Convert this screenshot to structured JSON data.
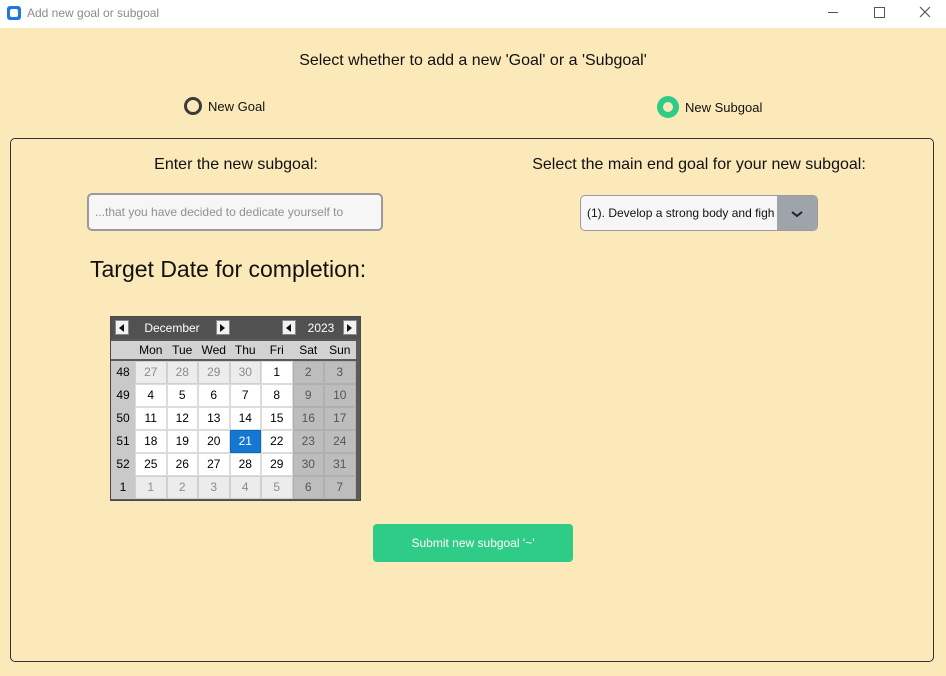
{
  "window": {
    "title": "Add new goal or subgoal"
  },
  "heading": "Select whether to add a new 'Goal' or a 'Subgoal'",
  "radios": [
    {
      "label": "New Goal",
      "checked": false
    },
    {
      "label": "New Subgoal",
      "checked": true
    }
  ],
  "left": {
    "label": "Enter the new subgoal:",
    "placeholder": "...that you have decided to dedicate yourself to"
  },
  "right": {
    "label": "Select the main end goal for your new subgoal:",
    "selected": "(1). Develop a strong body and figh"
  },
  "target_label": "Target Date for completion:",
  "calendar": {
    "month": "December",
    "year": "2023",
    "weekdays": [
      "Mon",
      "Tue",
      "Wed",
      "Thu",
      "Fri",
      "Sat",
      "Sun"
    ],
    "weeks": [
      {
        "num": "48",
        "days": [
          "27",
          "28",
          "29",
          "30",
          "1",
          "2",
          "3"
        ]
      },
      {
        "num": "49",
        "days": [
          "4",
          "5",
          "6",
          "7",
          "8",
          "9",
          "10"
        ]
      },
      {
        "num": "50",
        "days": [
          "11",
          "12",
          "13",
          "14",
          "15",
          "16",
          "17"
        ]
      },
      {
        "num": "51",
        "days": [
          "18",
          "19",
          "20",
          "21",
          "22",
          "23",
          "24"
        ]
      },
      {
        "num": "52",
        "days": [
          "25",
          "26",
          "27",
          "28",
          "29",
          "30",
          "31"
        ]
      },
      {
        "num": "1",
        "days": [
          "1",
          "2",
          "3",
          "4",
          "5",
          "6",
          "7"
        ]
      }
    ],
    "selected_day": "21"
  },
  "submit_label": "Submit new subgoal '~'",
  "colors": {
    "accent": "#2ecc87",
    "background": "#fce9b9",
    "selected_day": "#1478d2"
  }
}
